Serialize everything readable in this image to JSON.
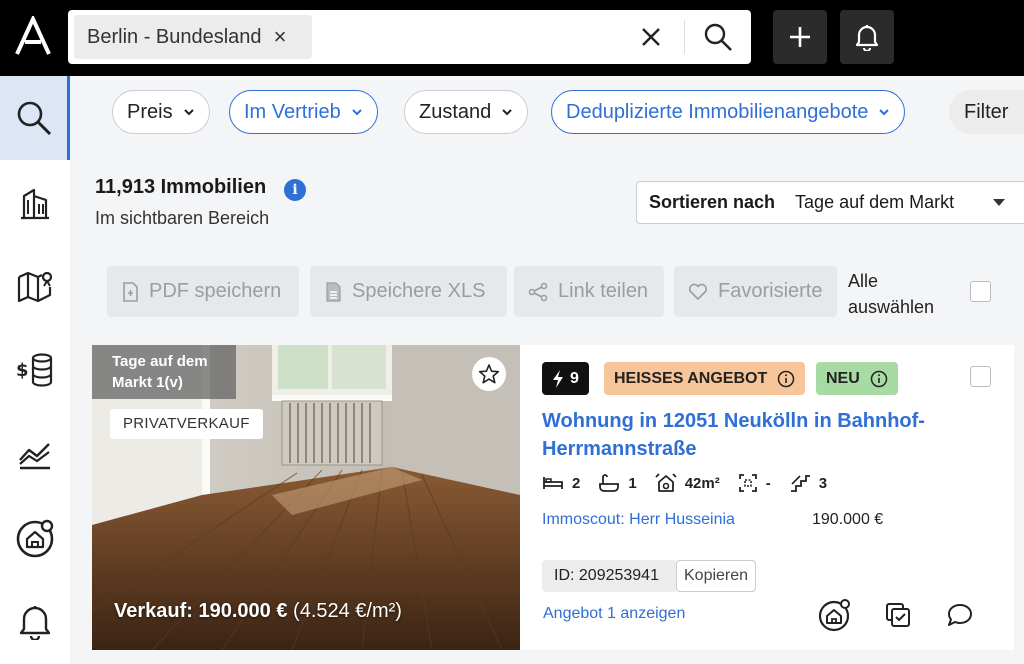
{
  "search": {
    "chip_label": "Berlin - Bundesland"
  },
  "icons": {
    "logo": "logo-icon",
    "clear": "close-icon",
    "search": "search-icon",
    "add": "plus-icon",
    "notifications": "bell-icon",
    "sidebar": [
      "search-icon",
      "buildings-icon",
      "map-icon",
      "money-stack-icon",
      "chart-icon",
      "home-target-icon",
      "bell-icon"
    ]
  },
  "filters": [
    {
      "label": "Preis"
    },
    {
      "label": "Im Vertrieb"
    },
    {
      "label": "Zustand"
    },
    {
      "label": "Deduplizierte Immobilienangebote"
    },
    {
      "label": "Filter"
    }
  ],
  "results": {
    "count": "11,913 Immobilien",
    "area": "Im sichtbaren Bereich",
    "info": "i"
  },
  "sort": {
    "label": "Sortieren nach",
    "value": "Tage auf dem Markt"
  },
  "actions": {
    "pdf": "PDF speichern",
    "xls": "Speichere XLS",
    "share": "Link teilen",
    "favorite": "Favorisierte",
    "select_all": "Alle auswählen"
  },
  "listing": {
    "days_on_market": "Tage auf dem Markt 1(v)",
    "sale_type": "PRIVATVERKAUF",
    "price_overlay_main": "Verkauf: 190.000 €",
    "price_overlay_sqm": "(4.524 €/m²)",
    "score": "9",
    "badge_hot": "HEISSES ANGEBOT",
    "badge_new": "NEU",
    "title": "Wohnung in 12051 Neukölln in Bahnhof-Herrmannstraße",
    "bedrooms": "2",
    "bathrooms": "1",
    "size": "42m²",
    "plot": "-",
    "floor": "3",
    "provider": "Immoscout: Herr Husseinia",
    "price": "190.000 €",
    "id": "ID: 209253941",
    "copy": "Kopieren",
    "show_offer": "Angebot 1 anzeigen"
  },
  "colors": {
    "accent": "#2f6fd6",
    "hot": "#f7c59a",
    "new": "#a8dba3"
  }
}
